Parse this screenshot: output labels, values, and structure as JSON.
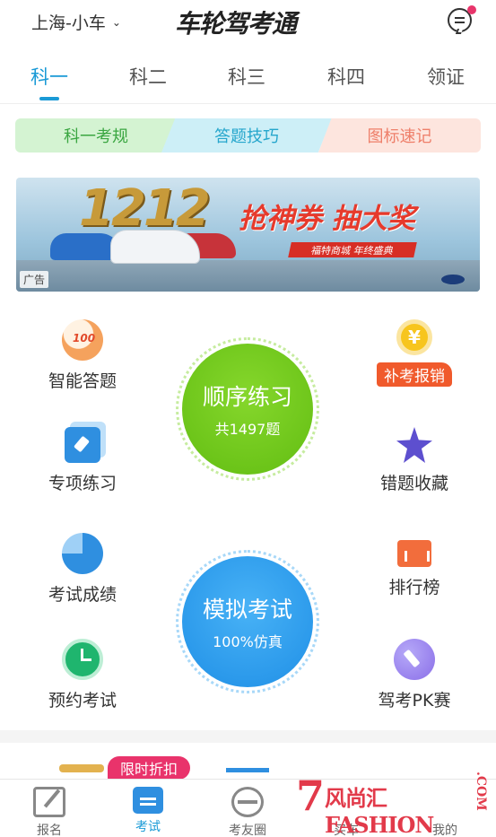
{
  "header": {
    "city": "上海-小车",
    "brand": "车轮驾考通"
  },
  "tabs": [
    "科一",
    "科二",
    "科三",
    "科四",
    "领证"
  ],
  "chips": [
    "科一考规",
    "答题技巧",
    "图标速记"
  ],
  "ad": {
    "tag": "广告",
    "big_text": "1212",
    "slogan": "抢神券 抽大奖",
    "banner": "福特商城 年终盛典"
  },
  "left_items": [
    "智能答题",
    "专项练习",
    "考试成绩",
    "预约考试"
  ],
  "right_items": {
    "reimburse": "补考报销",
    "wrong": "错题收藏",
    "rank": "排行榜",
    "pk": "驾考PK赛"
  },
  "sequential": {
    "title": "顺序练习",
    "subtitle": "共1497题"
  },
  "mock": {
    "title": "模拟考试",
    "subtitle": "100%仿真"
  },
  "promo": "限时折扣",
  "tabbar": [
    "报名",
    "考试",
    "考友圈",
    "买车",
    "我的"
  ],
  "watermark": {
    "num": "7",
    "cn": "风尚汇",
    "en": "FASHION",
    "com": ".COM"
  },
  "colors": {
    "accent": "#1a9ad6",
    "green": "#6fc619",
    "blue": "#2a9cef",
    "promo": "#e9336b"
  }
}
